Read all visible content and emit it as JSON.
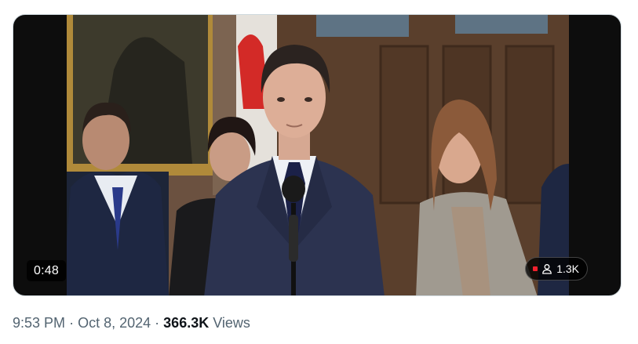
{
  "video": {
    "duration": "0:48",
    "viewer_count": "1.3K",
    "live_indicator_color": "#f4212e"
  },
  "post_meta": {
    "time": "9:53 PM",
    "date": "Oct 8, 2024",
    "separator": "·",
    "views_count": "366.3K",
    "views_label": "Views"
  },
  "colors": {
    "meta_text": "#536471",
    "emphasis_text": "#0f1419"
  },
  "icons": {
    "viewer": "person-icon",
    "live": "live-dot-icon"
  }
}
